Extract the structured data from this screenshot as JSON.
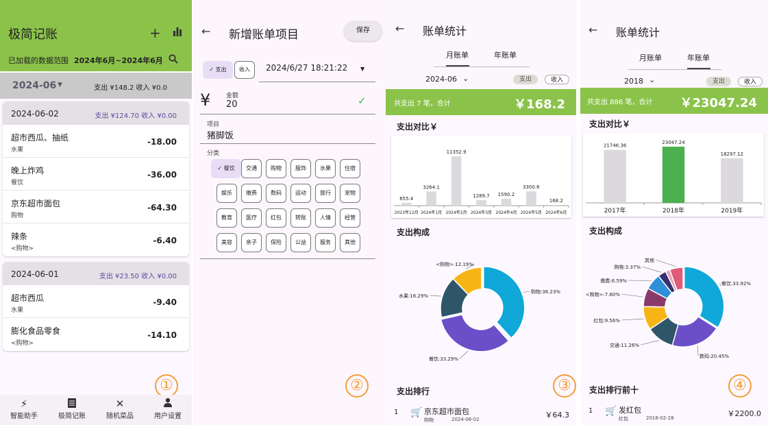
{
  "p1": {
    "title": "极简记账",
    "range_label": "已加载的数据范围",
    "range_value": "2024年6月~2024年6月",
    "month": "2024-06",
    "month_summary": "支出 ¥148.2  收入 ¥0.0",
    "days": [
      {
        "date": "2024-06-02",
        "summary": "支出 ¥124.70 收入 ¥0.00",
        "items": [
          {
            "name": "超市西瓜、抽纸",
            "cat": "水果",
            "amount": "-18.00"
          },
          {
            "name": "晚上炸鸡",
            "cat": "餐饮",
            "amount": "-36.00"
          },
          {
            "name": "京东超市面包",
            "cat": "购物",
            "amount": "-64.30"
          },
          {
            "name": "辣条",
            "cat": "<购物>",
            "amount": "-6.40"
          }
        ]
      },
      {
        "date": "2024-06-01",
        "summary": "支出 ¥23.50 收入 ¥0.00",
        "items": [
          {
            "name": "超市西瓜",
            "cat": "水果",
            "amount": "-9.40"
          },
          {
            "name": "膨化食品零食",
            "cat": "<购物>",
            "amount": "-14.10"
          }
        ]
      }
    ],
    "nav": [
      "智能助手",
      "极简记账",
      "随机菜品",
      "用户设置"
    ],
    "marker": "①"
  },
  "p2": {
    "title": "新增账单项目",
    "save": "保存",
    "expense": "支出",
    "income": "收入",
    "datetime": "2024/6/27 18:21:22",
    "amount_label": "金额",
    "amount": "20",
    "currency": "¥",
    "item_label": "项目",
    "item": "猪脚饭",
    "cat_label": "分类",
    "categories": [
      "餐饮",
      "交通",
      "购物",
      "服饰",
      "水果",
      "住宿",
      "娱乐",
      "缴费",
      "数码",
      "运动",
      "旅行",
      "宠物",
      "教育",
      "医疗",
      "红包",
      "转账",
      "人情",
      "经营",
      "美容",
      "亲子",
      "保险",
      "公益",
      "服务",
      "其他"
    ],
    "marker": "②"
  },
  "p3": {
    "title": "账单统计",
    "tab_month": "月账单",
    "tab_year": "年账单",
    "period": "2024-06",
    "expense": "支出",
    "income": "收入",
    "summary_text": "共支出 7 笔，合计",
    "summary_value": "￥168.2",
    "compare_title": "支出对比￥",
    "compose_title": "支出构成",
    "rank_title": "支出排行",
    "rank": {
      "idx": "1",
      "name": "京东超市面包",
      "cat": "购物",
      "date": "2024-06-02",
      "value": "￥64.3"
    },
    "marker": "③"
  },
  "p4": {
    "title": "账单统计",
    "tab_month": "月账单",
    "tab_year": "年账单",
    "period": "2018",
    "expense": "支出",
    "income": "收入",
    "summary_text": "共支出 886 笔，合计",
    "summary_value": "￥23047.24",
    "compare_title": "支出对比￥",
    "compose_title": "支出构成",
    "rank_title": "支出排行前十",
    "rank": {
      "idx": "1",
      "name": "发红包",
      "cat": "红包",
      "date": "2018-02-28",
      "value": "￥2200.0"
    },
    "marker": "④"
  },
  "chart_data": [
    {
      "type": "bar",
      "title": "支出对比￥",
      "categories": [
        "2023年12月",
        "2024年1月",
        "2024年2月",
        "2024年3月",
        "2024年4月",
        "2024年5月",
        "2024年6月"
      ],
      "values": [
        655.4,
        3264.1,
        11352.9,
        1289.7,
        1590.2,
        3300.6,
        168.2
      ],
      "highlight_index": 6,
      "colors": {
        "bar": "#dcd9de",
        "highlight": "#4caf50"
      }
    },
    {
      "type": "pie",
      "title": "支出构成",
      "labels": [
        "购物",
        "餐饮",
        "水果",
        "<购物>"
      ],
      "values": [
        38.23,
        33.29,
        16.29,
        12.19
      ],
      "label_text": [
        "购物:38.23%",
        "餐饮:33.29%",
        "水果:16.29%",
        "<购物>:12.19%"
      ],
      "colors": [
        "#0fa8d8",
        "#6a4fc9",
        "#2f5568",
        "#f7b515"
      ]
    },
    {
      "type": "bar",
      "title": "支出对比￥",
      "categories": [
        "2017年",
        "2018年",
        "2019年"
      ],
      "values": [
        21746.36,
        23047.24,
        18297.12
      ],
      "highlight_index": 1,
      "colors": {
        "bar": "#dcd9de",
        "highlight": "#4caf50"
      }
    },
    {
      "type": "pie",
      "title": "支出构成",
      "labels": [
        "餐饮",
        "数码",
        "交通",
        "红包",
        "<购物>",
        "缴费",
        "购物",
        "其他",
        "其他2"
      ],
      "values": [
        33.92,
        20.45,
        11.26,
        9.56,
        7.6,
        6.59,
        3.37,
        1.8,
        5.45
      ],
      "label_text": [
        "餐饮:33.92%",
        "数码:20.45%",
        "交通:11.26%",
        "红包:9.56%",
        "<购物>:7.60%",
        "缴费:6.59%",
        "购物:3.37%",
        "",
        "其他"
      ],
      "colors": [
        "#0fa8d8",
        "#6a4fc9",
        "#2f5568",
        "#f7b515",
        "#8a3a6a",
        "#2f8fd8",
        "#3a2f70",
        "#e8a0b0",
        "#e05a7a"
      ]
    }
  ]
}
